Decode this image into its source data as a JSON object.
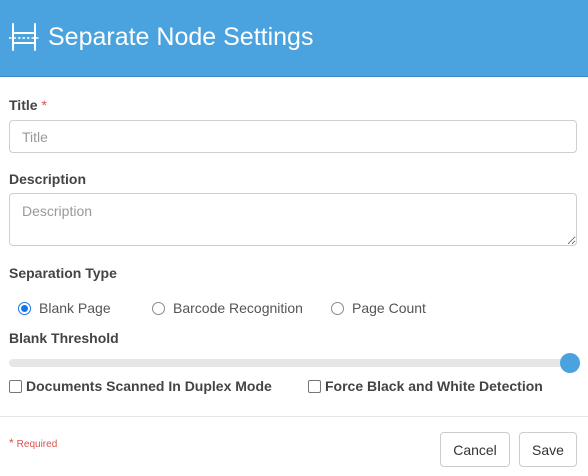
{
  "header": {
    "title": "Separate Node Settings",
    "icon": "separator-node-icon",
    "background": "#4aa3df"
  },
  "form": {
    "title_label": "Title",
    "title_required_mark": "*",
    "title_placeholder": "Title",
    "title_value": "",
    "description_label": "Description",
    "description_placeholder": "Description",
    "description_value": "",
    "separation_type_label": "Separation Type",
    "separation_types": [
      {
        "label": "Blank Page",
        "checked": true
      },
      {
        "label": "Barcode Recognition",
        "checked": false
      },
      {
        "label": "Page Count",
        "checked": false
      }
    ],
    "blank_threshold_label": "Blank Threshold",
    "blank_threshold_value": 1.0,
    "duplex_label": "Documents Scanned In Duplex Mode",
    "duplex_checked": false,
    "bw_detection_label": "Force Black and White Detection",
    "bw_detection_checked": false
  },
  "footer": {
    "required_mark": "*",
    "required_text": "Required",
    "cancel_label": "Cancel",
    "save_label": "Save"
  },
  "colors": {
    "accent": "#4aa3df",
    "radio_selected": "#1a73e8",
    "required": "#d9534f"
  }
}
